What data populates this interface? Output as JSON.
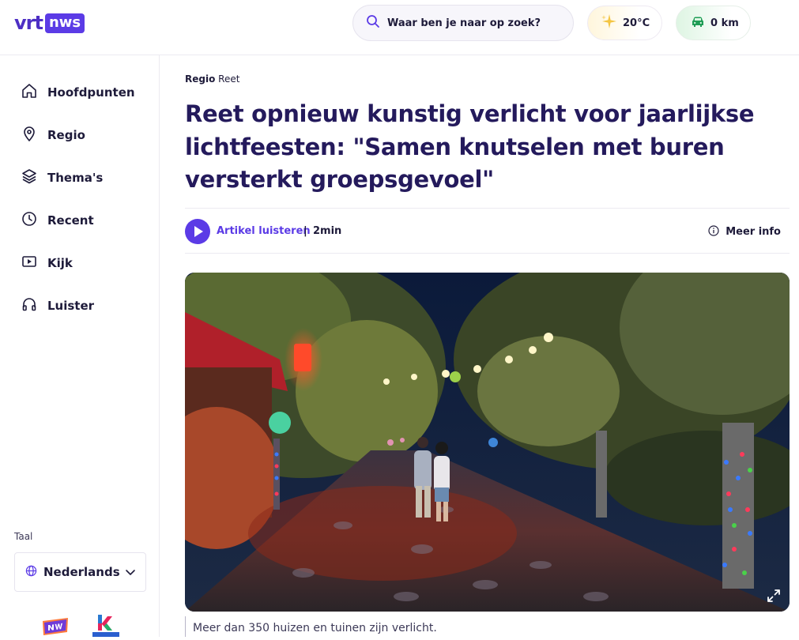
{
  "header": {
    "logo_text": "vrt",
    "logo_badge": "nws",
    "search_placeholder": "Waar ben je naar op zoek?",
    "weather": "20°C",
    "traffic": "0 km"
  },
  "sidebar": {
    "items": [
      {
        "label": "Hoofdpunten",
        "icon": "home-icon"
      },
      {
        "label": "Regio",
        "icon": "location-pin-icon"
      },
      {
        "label": "Thema's",
        "icon": "layers-icon"
      },
      {
        "label": "Recent",
        "icon": "clock-icon"
      },
      {
        "label": "Kijk",
        "icon": "play-screen-icon"
      },
      {
        "label": "Luister",
        "icon": "headphones-icon"
      }
    ],
    "language_label": "Taal",
    "language_value": "Nederlands"
  },
  "article": {
    "breadcrumb_section": "Regio",
    "breadcrumb_place": "Reet",
    "title": "Reet opnieuw kunstig verlicht voor jaarlijkse lichtfeesten: \"Samen knutselen met buren versterkt groepsgevoel\"",
    "listen_label": "Artikel luisteren",
    "separator": "|",
    "duration": "2min",
    "more_info": "Meer info",
    "caption": "Meer dan 350 huizen en tuinen zijn verlicht."
  },
  "colors": {
    "brand": "#5b3be6",
    "title": "#241a5c",
    "text": "#1e1b3a"
  }
}
